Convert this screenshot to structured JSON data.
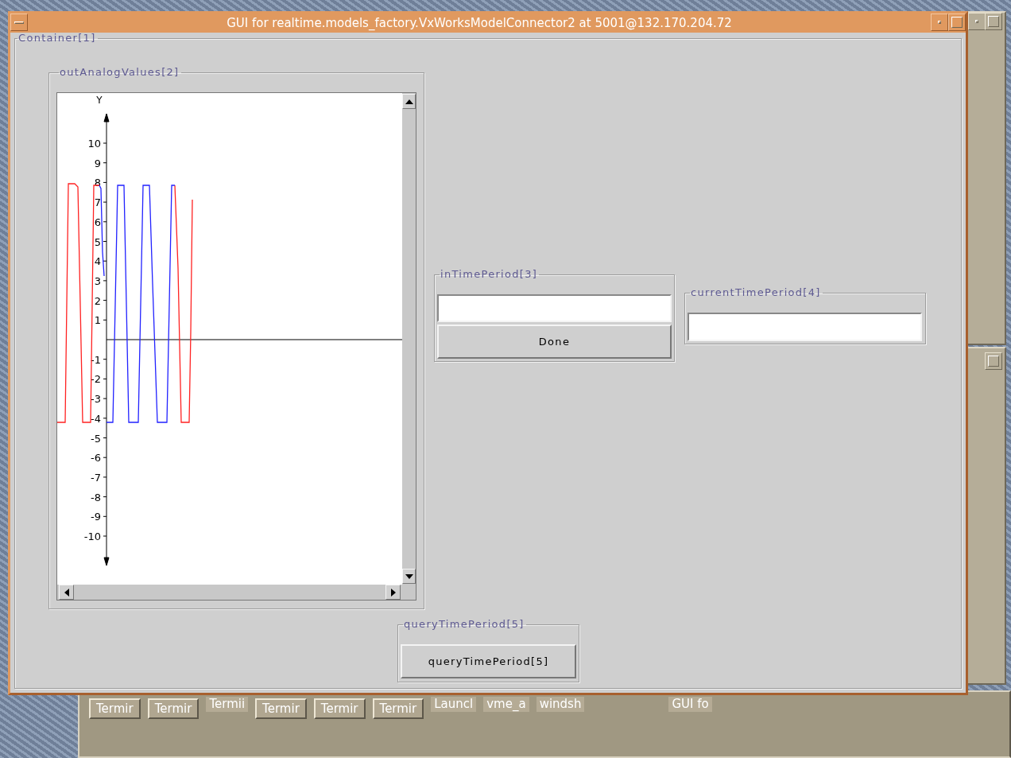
{
  "window": {
    "title": "GUI for realtime.models_factory.VxWorksModelConnector2 at 5001@132.170.204.72"
  },
  "container": {
    "label": "Container[1]"
  },
  "out_analog_values": {
    "label": "outAnalogValues[2]",
    "plot": {
      "axis_label": "Y",
      "y_ticks": [
        "10",
        "9",
        "8",
        "7",
        "6",
        "5",
        "4",
        "3",
        "2",
        "1",
        "-1",
        "-2",
        "-3",
        "-4",
        "-5",
        "-6",
        "-7",
        "-8",
        "-9",
        "-10"
      ]
    }
  },
  "in_time_period": {
    "label": "inTimePeriod[3]",
    "button": "Done"
  },
  "current_time_period": {
    "label": "currentTimePeriod[4]"
  },
  "query_time_period": {
    "label": "queryTimePeriod[5]",
    "button": "queryTimePeriod[5]"
  },
  "taskbar": {
    "items": [
      {
        "label": "Termir",
        "kind": "raised"
      },
      {
        "label": "Termir",
        "kind": "raised"
      },
      {
        "label": "Termii",
        "kind": "flat"
      },
      {
        "label": "Termir",
        "kind": "raised"
      },
      {
        "label": "Termir",
        "kind": "raised"
      },
      {
        "label": "Termir",
        "kind": "raised"
      },
      {
        "label": "Launcl",
        "kind": "flat"
      },
      {
        "label": "vme_a",
        "kind": "flat"
      },
      {
        "label": "windsh",
        "kind": "flat"
      },
      {
        "label": "GUI fo",
        "kind": "flat"
      }
    ]
  }
}
